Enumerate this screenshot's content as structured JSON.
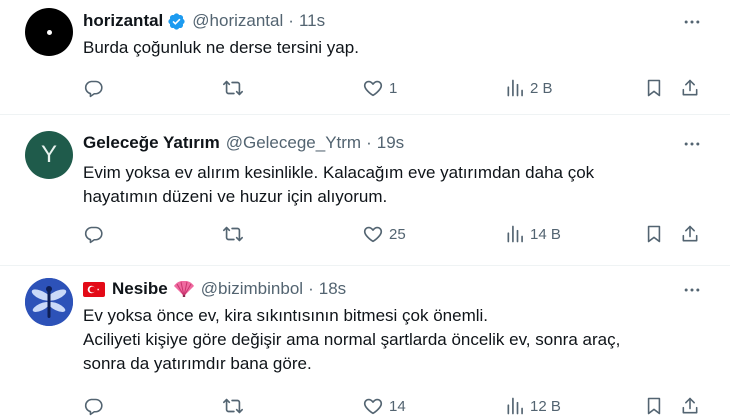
{
  "tweets": [
    {
      "name": "horizantal",
      "handle": "@horizantal",
      "sep": "·",
      "time": "11s",
      "verified": true,
      "avatar": "black-dot-avatar",
      "lines": [
        "Burda çoğunluk ne derse tersini yap."
      ],
      "likes": "1",
      "views": "2 B"
    },
    {
      "name": "Geleceğe Yatırım",
      "handle": "@Gelecege_Ytrm",
      "sep": "·",
      "time": "19s",
      "avatar_letter": "Y",
      "lines": [
        "Evim yoksa ev alırım kesinlikle. Kalacağım eve yatırımdan daha çok",
        "hayatımın düzeni ve huzur için alıyorum."
      ],
      "likes": "25",
      "views": "14 B"
    },
    {
      "name": "Nesibe",
      "handle": "@bizimbinbol",
      "sep": "·",
      "time": "18s",
      "avatar": "dragonfly-avatar",
      "lines": [
        "Ev yoksa önce ev, kira sıkıntısının bitmesi çok önemli.",
        "Aciliyeti kişiye göre değişir ama normal şartlarda öncelik ev, sonra araç,",
        "sonra da yatırımdır bana göre."
      ],
      "likes": "14",
      "views": "12 B"
    }
  ],
  "colors": {
    "text": "#0f1419",
    "muted": "#536471",
    "verified": "#1d9bf0",
    "divider": "#eff3f4"
  }
}
